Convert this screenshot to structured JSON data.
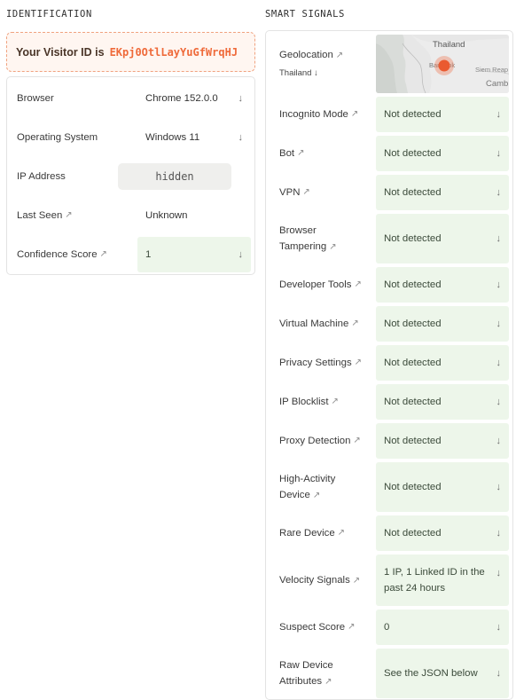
{
  "identification": {
    "title": "IDENTIFICATION",
    "visitor_id_label": "Your Visitor ID is",
    "visitor_id": "EKpj0OtlLayYuGfWrqHJ",
    "rows": {
      "browser": {
        "label": "Browser",
        "value": "Chrome 152.0.0"
      },
      "os": {
        "label": "Operating System",
        "value": "Windows 11"
      },
      "ip": {
        "label": "IP Address",
        "value": "hidden"
      },
      "last_seen": {
        "label": "Last Seen",
        "value": "Unknown"
      },
      "confidence": {
        "label": "Confidence Score",
        "value": "1"
      }
    }
  },
  "smart_signals": {
    "title": "SMART SIGNALS",
    "geolocation": {
      "label": "Geolocation",
      "country": "Thailand",
      "map_labels": {
        "country": "Thailand",
        "city": "Bangkok",
        "siem_reap": "Siem Reap",
        "cambodia": "Camb"
      }
    },
    "rows": {
      "incognito": {
        "label": "Incognito Mode",
        "value": "Not detected"
      },
      "bot": {
        "label": "Bot",
        "value": "Not detected"
      },
      "vpn": {
        "label": "VPN",
        "value": "Not detected"
      },
      "tampering": {
        "label": "Browser Tampering",
        "value": "Not detected"
      },
      "devtools": {
        "label": "Developer Tools",
        "value": "Not detected"
      },
      "vm": {
        "label": "Virtual Machine",
        "value": "Not detected"
      },
      "privacy": {
        "label": "Privacy Settings",
        "value": "Not detected"
      },
      "blocklist": {
        "label": "IP Blocklist",
        "value": "Not detected"
      },
      "proxy": {
        "label": "Proxy Detection",
        "value": "Not detected"
      },
      "high_activity": {
        "label": "High-Activity Device",
        "value": "Not detected"
      },
      "rare": {
        "label": "Rare Device",
        "value": "Not detected"
      },
      "velocity": {
        "label": "Velocity Signals",
        "value": "1 IP, 1 Linked ID in the past 24 hours"
      },
      "suspect": {
        "label": "Suspect Score",
        "value": "0"
      },
      "raw": {
        "label": "Raw Device Attributes",
        "value": "See the JSON below"
      }
    }
  },
  "glyphs": {
    "link_arrow": "↗",
    "down_arrow": "↓"
  },
  "colors": {
    "accent": "#ef6a3a",
    "green_cell": "#edf6ea",
    "pill": "#efefed"
  }
}
